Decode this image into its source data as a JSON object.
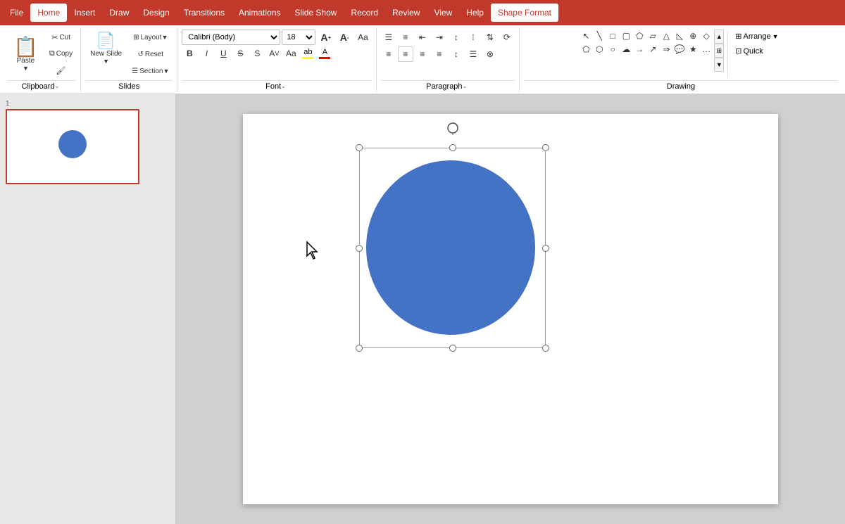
{
  "menubar": {
    "items": [
      {
        "label": "File",
        "active": false
      },
      {
        "label": "Home",
        "active": true
      },
      {
        "label": "Insert",
        "active": false
      },
      {
        "label": "Draw",
        "active": false
      },
      {
        "label": "Design",
        "active": false
      },
      {
        "label": "Transitions",
        "active": false
      },
      {
        "label": "Animations",
        "active": false
      },
      {
        "label": "Slide Show",
        "active": false
      },
      {
        "label": "Record",
        "active": false
      },
      {
        "label": "Review",
        "active": false
      },
      {
        "label": "View",
        "active": false
      },
      {
        "label": "Help",
        "active": false
      },
      {
        "label": "Shape Format",
        "active": false,
        "special": true
      }
    ]
  },
  "ribbon": {
    "clipboard_group": {
      "label": "Clipboard",
      "paste_label": "Paste",
      "cut_label": "Cut",
      "copy_label": "Copy",
      "format_painter_label": "Format Painter"
    },
    "slides_group": {
      "label": "Slides",
      "new_slide_label": "New Slide",
      "layout_label": "Layout",
      "reset_label": "Reset",
      "section_label": "Section"
    },
    "font_group": {
      "label": "Font",
      "font_name": "Calibri (Body)",
      "font_size": "18",
      "bold": "B",
      "italic": "I",
      "underline": "U",
      "strikethrough": "S",
      "shadow": "S",
      "expand_icon": "⌄"
    },
    "paragraph_group": {
      "label": "Paragraph",
      "expand_icon": "⌄"
    },
    "drawing_group": {
      "label": "Drawing"
    }
  },
  "slide": {
    "number": "1",
    "circle_color": "#4472C4"
  },
  "canvas": {
    "background": "#ffffff"
  },
  "cursor": {
    "visible": true
  },
  "colors": {
    "accent": "#c0392b",
    "ribbon_bg": "#ffffff",
    "menu_bg": "#c0392b",
    "active_tab": "#ffffff",
    "shape_color": "#4472C4",
    "shape_format_color": "#c0392b"
  }
}
